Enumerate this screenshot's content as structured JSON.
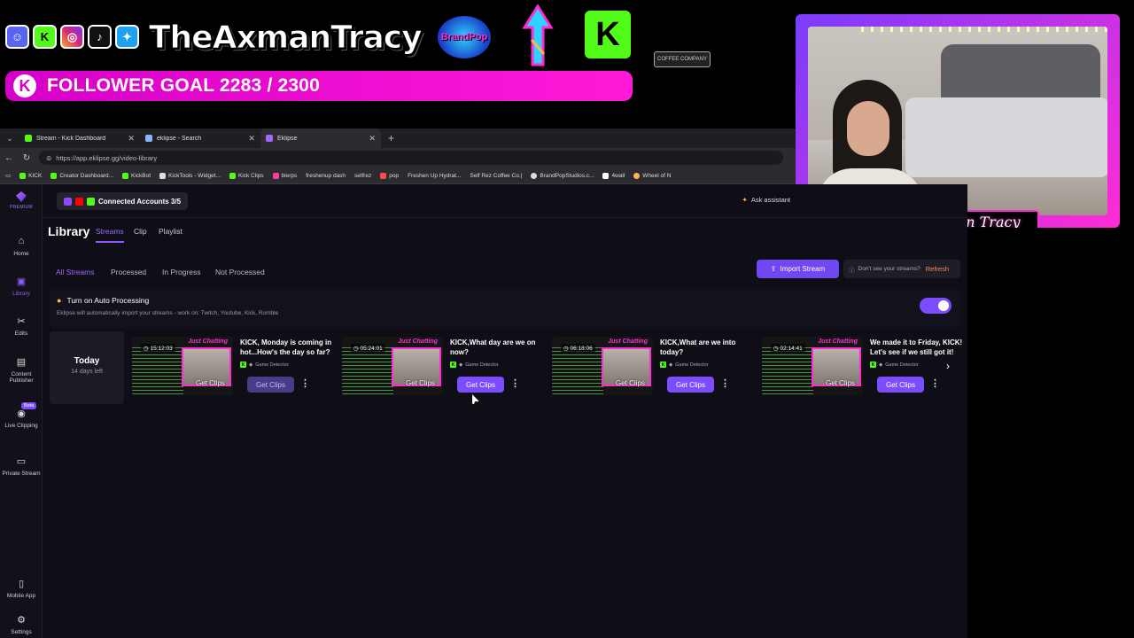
{
  "overlay": {
    "channel_name": "TheAxmanTracy",
    "brandpop_logo_text": "BrandPop",
    "kick_logo_text": "K",
    "coffee_logo_text": "COFFEE COMPANY",
    "goal_icon": "K",
    "goal_text": "FOLLOWER GOAL 2283 / 2300",
    "social_icons": [
      "discord-icon",
      "kick-icon",
      "instagram-icon",
      "tiktok-icon",
      "twitter-icon"
    ]
  },
  "webcam": {
    "label": "TheAxman Tracy"
  },
  "browser": {
    "tabs": [
      {
        "title": "Stream - Kick Dashboard",
        "color": "#53fc18"
      },
      {
        "title": "eklipse - Search",
        "color": "#8ab4f8"
      },
      {
        "title": "Eklipse",
        "color": "#9a6bff"
      }
    ],
    "url": "https://app.eklipse.gg/video-library",
    "bookmarks": [
      "KICK",
      "Creator Dashboard...",
      "KickBot",
      "KickTools - Widget...",
      "Kick Clips",
      "blerps",
      "freshenup dash",
      "selfrez",
      "pop",
      "Freshen Up Hydrat...",
      "Self Rez Coffee Co.|",
      "BrandPopStudios.c...",
      "4wall",
      "Wheel of N"
    ]
  },
  "app": {
    "brand_sub": "PREMIUM",
    "sidebar": [
      {
        "label": "Home",
        "icon": "⌂"
      },
      {
        "label": "Library",
        "icon": "▣"
      },
      {
        "label": "Edits",
        "icon": "✂"
      },
      {
        "label": "Content Publisher",
        "icon": "▤"
      },
      {
        "label": "Live Clipping",
        "icon": "◉",
        "badge": "Beta"
      },
      {
        "label": "Private Stream",
        "icon": "▭"
      },
      {
        "label": "Mobile App",
        "icon": "▯"
      },
      {
        "label": "Settings",
        "icon": "⚙"
      }
    ],
    "connected_accounts": "Connected Accounts 3/5",
    "ask_assistant": "Ask assistant",
    "library_title": "Library",
    "library_tabs": [
      "Streams",
      "Clip",
      "Playlist"
    ],
    "filters": [
      "All Streams",
      "Processed",
      "In Progress",
      "Not Processed"
    ],
    "import_button": "Import Stream",
    "help_text": "Don't see your streams?",
    "refresh": "Refresh",
    "auto_title": "Turn on Auto Processing",
    "auto_sub": "Eklipse will automatically import your streams - work on: Twitch, Youtube, Kick, Rumble",
    "today_label": "Today",
    "today_sub": "14 days left",
    "streams": [
      {
        "duration": "15:12:03",
        "category": "Just Chatting",
        "title": "KICK, Monday is coming in hot...How's the day so far?",
        "detector": "Game Detector",
        "button": "Get Clips",
        "overlay_text": "Get Clips",
        "dim": true
      },
      {
        "duration": "05:24:01",
        "category": "Just Chatting",
        "title": "KICK,What day are we on now?",
        "detector": "Game Detector",
        "button": "Get Clips",
        "overlay_text": "Get Clips",
        "dim": false
      },
      {
        "duration": "06:18:06",
        "category": "Just Chatting",
        "title": "KICK,What are we into today?",
        "detector": "Game Detector",
        "button": "Get Clips",
        "overlay_text": "Get Clips",
        "dim": false
      },
      {
        "duration": "02:14:41",
        "category": "Just Chatting",
        "title": "We made it to Friday, KICK! Let's see if we still got it!",
        "detector": "Game Detector",
        "button": "Get Clips",
        "overlay_text": "Get Clips",
        "dim": false
      }
    ]
  }
}
